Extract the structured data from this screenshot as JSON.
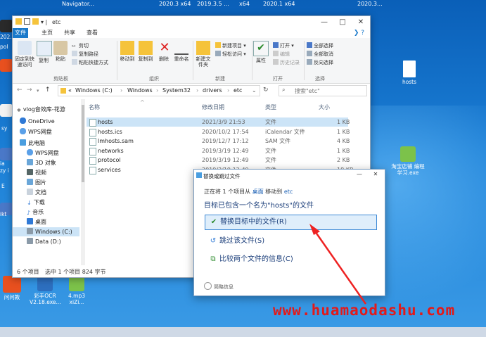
{
  "desktop": {
    "top_labels": [
      "Navigator...",
      "2020.3 x64",
      "2019.3.5 ...",
      "x64",
      "2020.1 x64",
      "2020.3..."
    ],
    "left_labels": [
      "202...",
      "pol",
      "sy",
      "ia",
      "zy i",
      "E",
      "ikt"
    ],
    "icons": [
      {
        "label": "hosts"
      },
      {
        "label": "淘宝店铺 编程学习.exe"
      },
      {
        "label": "问问教"
      },
      {
        "label": "彩手OCR V2.18.exe..."
      },
      {
        "label": "4.mp3 xiZi..."
      }
    ]
  },
  "explorer": {
    "title": "etc",
    "tabs": [
      "文件",
      "主页",
      "共享",
      "查看"
    ],
    "ribbon": {
      "pin_label": "固定到快速访问",
      "copy_label": "复制",
      "paste_label": "粘贴",
      "cut_label": "剪切",
      "copy_path_label": "复制路径",
      "paste_shortcut_label": "粘贴快捷方式",
      "move_to_label": "移动到",
      "copy_to_label": "复制到",
      "delete_label": "删除",
      "rename_label": "重命名",
      "new_folder_label": "新建文件夹",
      "new_item_label": "新建项目",
      "easy_access_label": "轻松访问",
      "properties_label": "属性",
      "open_label": "打开",
      "edit_label": "编辑",
      "history_label": "历史记录",
      "select_all_label": "全部选择",
      "select_none_label": "全部取消",
      "invert_label": "反向选择",
      "groups": {
        "clipboard": "剪贴板",
        "organize": "组织",
        "new": "新建",
        "open": "打开",
        "select": "选择"
      }
    },
    "path": {
      "root_marker": "«",
      "segments": [
        "Windows (C:)",
        "Windows",
        "System32",
        "drivers",
        "etc"
      ]
    },
    "search_placeholder": "搜索\"etc\"",
    "nav_items": [
      {
        "label": "vlog音效库-花游"
      },
      {
        "label": "OneDrive"
      },
      {
        "label": "WPS网盘"
      },
      {
        "label": "此电脑"
      },
      {
        "label": "WPS网盘"
      },
      {
        "label": "3D 对象"
      },
      {
        "label": "视频"
      },
      {
        "label": "图片"
      },
      {
        "label": "文档"
      },
      {
        "label": "下载"
      },
      {
        "label": "音乐"
      },
      {
        "label": "桌面"
      },
      {
        "label": "Windows (C:)"
      },
      {
        "label": "Data (D:)"
      }
    ],
    "columns": {
      "name": "名称",
      "modified": "修改日期",
      "type": "类型",
      "size": "大小"
    },
    "files": [
      {
        "name": "hosts",
        "modified": "2021/3/9 21:53",
        "type": "文件",
        "size": "1 KB"
      },
      {
        "name": "hosts.ics",
        "modified": "2020/10/2 17:54",
        "type": "iCalendar 文件",
        "size": "1 KB"
      },
      {
        "name": "lmhosts.sam",
        "modified": "2019/12/7 17:12",
        "type": "SAM 文件",
        "size": "4 KB"
      },
      {
        "name": "networks",
        "modified": "2019/3/19 12:49",
        "type": "文件",
        "size": "1 KB"
      },
      {
        "name": "protocol",
        "modified": "2019/3/19 12:49",
        "type": "文件",
        "size": "2 KB"
      },
      {
        "name": "services",
        "modified": "2019/3/19 12:49",
        "type": "文件",
        "size": "18 KB"
      }
    ],
    "status": {
      "count": "6 个项目",
      "selected": "选中 1 个项目  824 字节"
    }
  },
  "dialog": {
    "title": "替换或跳过文件",
    "info_prefix": "正在将 1 个项目从",
    "info_from": "桌面",
    "info_mid": "移动到",
    "info_to": "etc",
    "message": "目标已包含一个名为\"hosts\"的文件",
    "options": [
      {
        "label": "替换目标中的文件(R)"
      },
      {
        "label": "跳过该文件(S)"
      },
      {
        "label": "比较两个文件的信息(C)"
      }
    ],
    "more_label": "简略信息"
  },
  "watermark": "www.huamaodashu.com",
  "colors": {
    "accent": "#1979ca",
    "watermark": "#e21a1a",
    "selection": "#cce4f7"
  }
}
